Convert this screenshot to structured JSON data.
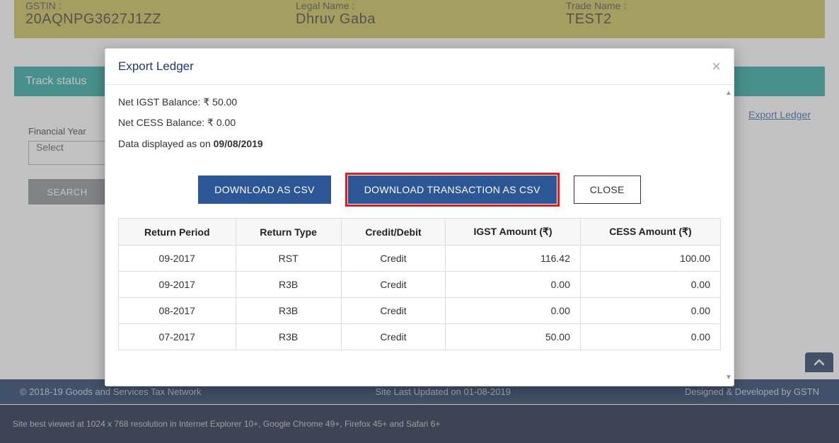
{
  "header": {
    "gstin_label": "GSTIN :",
    "gstin_value": "20AQNPG3627J1ZZ",
    "legal_label": "Legal Name :",
    "legal_value": "Dhruv Gaba",
    "trade_label": "Trade Name :",
    "trade_value": "TEST2"
  },
  "track_status": "Track status",
  "export_ledger_link": "Export Ledger",
  "financial_year_label": "Financial Year",
  "select_placeholder": "Select",
  "search_label": "SEARCH",
  "footer": {
    "copyright": "© 2018-19 Goods and Services Tax Network",
    "updated": "Site Last Updated on 01-08-2019",
    "designed": "Designed & Developed by GSTN",
    "compat": "Site best viewed at 1024 x 768 resolution in Internet Explorer 10+, Google Chrome 49+, Firefox 45+ and Safari 6+"
  },
  "modal": {
    "title": "Export Ledger",
    "igst_balance_label": "Net IGST Balance: ₹ ",
    "igst_balance_value": "50.00",
    "cess_balance_label": "Net CESS Balance: ₹ ",
    "cess_balance_value": "0.00",
    "data_as_on_prefix": "Data displayed as on ",
    "data_as_on_date": "09/08/2019",
    "btn_download_csv": "DOWNLOAD AS CSV",
    "btn_download_txn_csv": "DOWNLOAD TRANSACTION AS CSV",
    "btn_close": "CLOSE",
    "table": {
      "headers": [
        "Return Period",
        "Return Type",
        "Credit/Debit",
        "IGST Amount (₹)",
        "CESS Amount (₹)"
      ],
      "rows": [
        {
          "period": "09-2017",
          "type": "RST",
          "cd": "Credit",
          "igst": "116.42",
          "cess": "100.00"
        },
        {
          "period": "09-2017",
          "type": "R3B",
          "cd": "Credit",
          "igst": "0.00",
          "cess": "0.00"
        },
        {
          "period": "08-2017",
          "type": "R3B",
          "cd": "Credit",
          "igst": "0.00",
          "cess": "0.00"
        },
        {
          "period": "07-2017",
          "type": "R3B",
          "cd": "Credit",
          "igst": "50.00",
          "cess": "0.00"
        }
      ]
    }
  }
}
